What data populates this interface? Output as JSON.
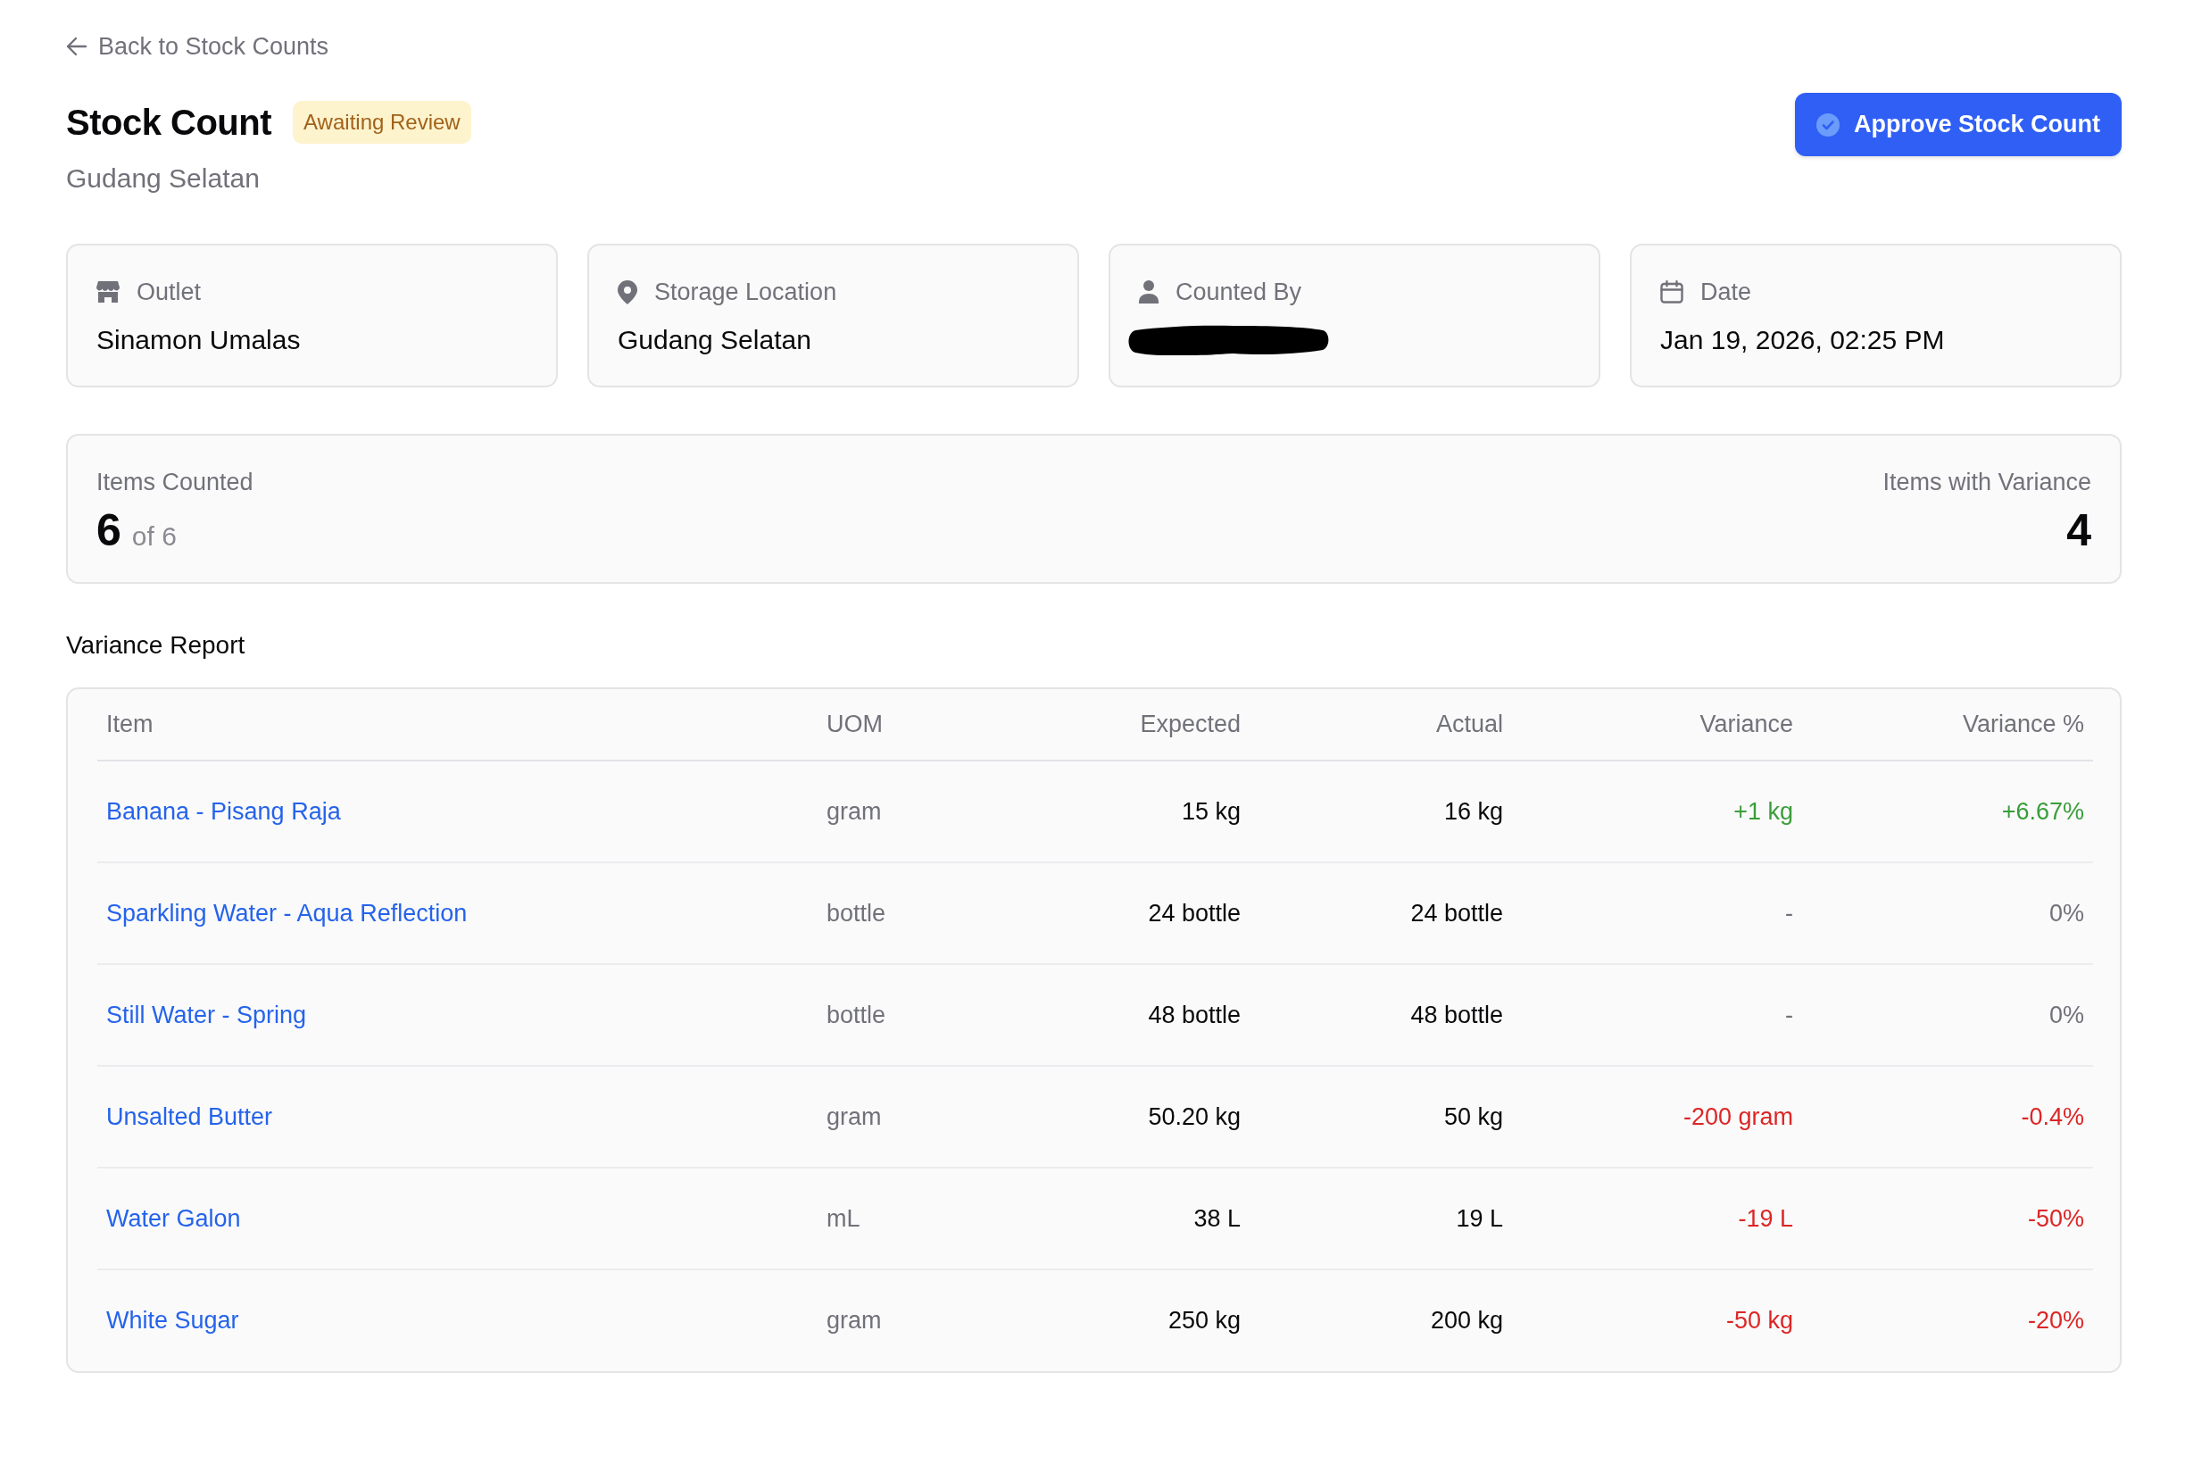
{
  "back_link": {
    "label": "Back to Stock Counts"
  },
  "header": {
    "title": "Stock Count",
    "status": {
      "label": "Awaiting Review"
    },
    "subtitle": "Gudang Selatan",
    "primary_action": {
      "label": "Approve Stock Count"
    }
  },
  "info_cards": [
    {
      "kind": "outlet",
      "label": "Outlet",
      "value": "Sinamon Umalas",
      "redacted": false
    },
    {
      "kind": "location",
      "label": "Storage Location",
      "value": "Gudang Selatan",
      "redacted": false
    },
    {
      "kind": "person",
      "label": "Counted By",
      "redacted": true
    },
    {
      "kind": "date",
      "label": "Date",
      "value": "Jan 19, 2026, 02:25 PM",
      "redacted": false
    }
  ],
  "summary": {
    "items_counted": {
      "label": "Items Counted",
      "value": "6",
      "total": "of 6"
    },
    "items_with_variance": {
      "label": "Items with Variance",
      "value": "4"
    }
  },
  "variance_report": {
    "title": "Variance Report",
    "table": {
      "columns": [
        "Item",
        "UOM",
        "Expected",
        "Actual",
        "Variance",
        "Variance %"
      ],
      "rows": [
        {
          "item": "Banana - Pisang Raja",
          "uom": "gram",
          "expected": "15 kg",
          "actual": "16 kg",
          "variance": "+1 kg",
          "variance_pct": "+6.67%",
          "color": "#3a9d3a"
        },
        {
          "item": "Sparkling Water - Aqua Reflection",
          "uom": "bottle",
          "expected": "24 bottle",
          "actual": "24 bottle",
          "variance": "-",
          "variance_pct": "0%",
          "color": "#71717a"
        },
        {
          "item": "Still Water - Spring",
          "uom": "bottle",
          "expected": "48 bottle",
          "actual": "48 bottle",
          "variance": "-",
          "variance_pct": "0%",
          "color": "#71717a"
        },
        {
          "item": "Unsalted Butter",
          "uom": "gram",
          "expected": "50.20 kg",
          "actual": "50 kg",
          "variance": "-200 gram",
          "variance_pct": "-0.4%",
          "color": "#dc2626"
        },
        {
          "item": "Water Galon",
          "uom": "mL",
          "expected": "38 L",
          "actual": "19 L",
          "variance": "-19 L",
          "variance_pct": "-50%",
          "color": "#dc2626"
        },
        {
          "item": "White Sugar",
          "uom": "gram",
          "expected": "250 kg",
          "actual": "200 kg",
          "variance": "-50 kg",
          "variance_pct": "-20%",
          "color": "#dc2626"
        }
      ]
    }
  }
}
